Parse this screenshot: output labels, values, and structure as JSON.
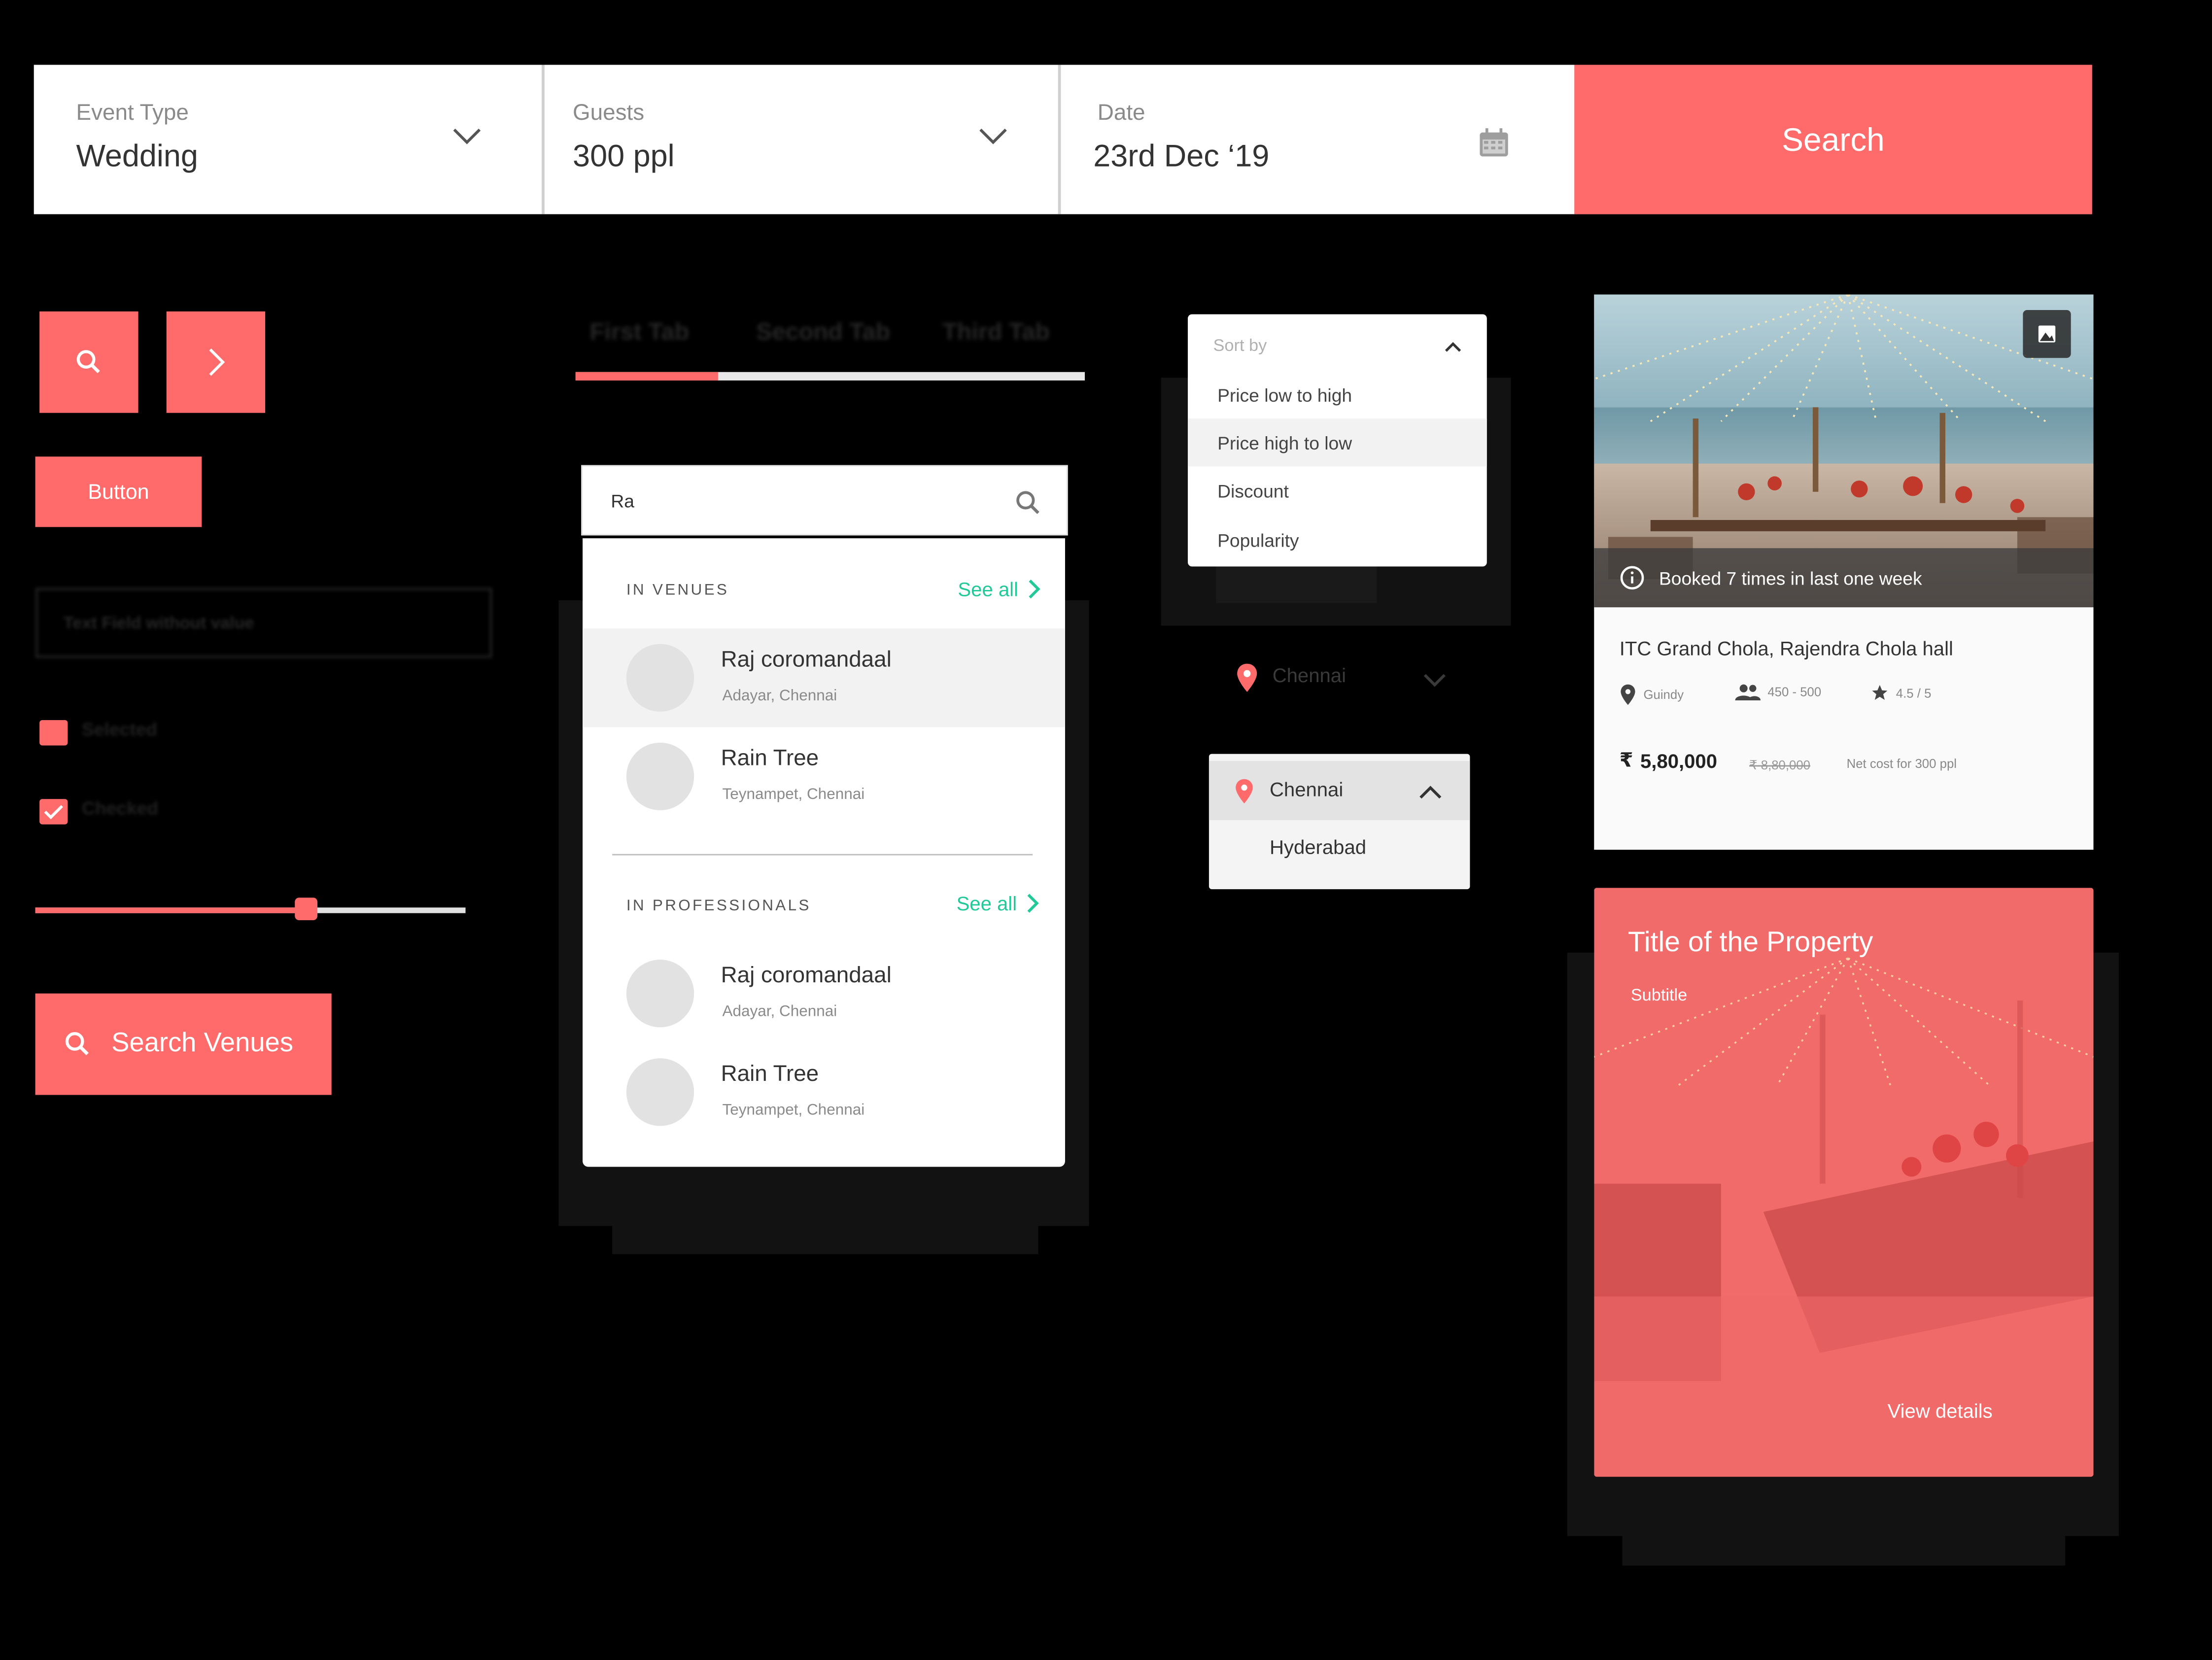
{
  "theme": {
    "accent": "#ff6b6b",
    "link": "#20c997"
  },
  "searchbar": {
    "event_type": {
      "label": "Event Type",
      "value": "Wedding",
      "icon": "chevron-down-icon"
    },
    "guests": {
      "label": "Guests",
      "value": "300 ppl",
      "icon": "chevron-down-icon"
    },
    "date": {
      "label": "Date",
      "value": "23rd Dec ‘19",
      "icon": "calendar-icon"
    },
    "search_label": "Search"
  },
  "controls": {
    "icon_search": "search-icon",
    "icon_next": "chevron-right-icon",
    "button_label": "Button",
    "textfield_value": "Text Field without value",
    "checkbox_selected": "Selected",
    "checkbox_checked": "Checked",
    "slider_value": 0.63,
    "search_venues_label": "Search Venues"
  },
  "tabs": [
    "First Tab",
    "Second Tab",
    "Third Tab"
  ],
  "autocomplete": {
    "query": "Ra",
    "venues_heading": "IN VENUES",
    "professionals_heading": "IN PROFESSIONALS",
    "see_all": "See all",
    "venues": [
      {
        "name": "Raj coromandaal",
        "location": "Adayar, Chennai"
      },
      {
        "name": "Rain Tree",
        "location": "Teynampet, Chennai"
      }
    ],
    "professionals": [
      {
        "name": "Raj coromandaal",
        "location": "Adayar, Chennai"
      },
      {
        "name": "Rain Tree",
        "location": "Teynampet, Chennai"
      }
    ]
  },
  "sort": {
    "heading": "Sort by",
    "options": [
      "Price low to high",
      "Price high to low",
      "Discount",
      "Popularity"
    ],
    "selected": "Price high to low"
  },
  "city_select_closed": {
    "value": "Chennai"
  },
  "city_select_open": {
    "options": [
      "Chennai",
      "Hyderabad"
    ]
  },
  "venue_card": {
    "badge": "Booked 7 times in last one week",
    "title": "ITC Grand Chola, Rajendra Chola hall",
    "area": "Guindy",
    "capacity": "450 - 500",
    "rating": "4.5 / 5",
    "price": "5,80,000",
    "old_price": "8,80,000",
    "net_note": "Net cost for 300 ppl",
    "currency": "₹"
  },
  "property_card": {
    "title": "Title of the Property",
    "subtitle": "Subtitle",
    "cta": "View details"
  }
}
